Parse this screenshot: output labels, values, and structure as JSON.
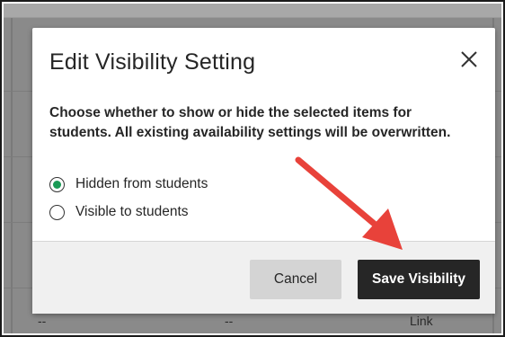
{
  "dialog": {
    "title": "Edit Visibility Setting",
    "prompt": "Choose whether to show or hide the selected items for students. All existing availability settings will be overwritten.",
    "options": [
      {
        "label": "Hidden from students",
        "selected": true
      },
      {
        "label": "Visible to students",
        "selected": false
      }
    ],
    "cancel_label": "Cancel",
    "save_label": "Save Visibility"
  },
  "background": {
    "cells": [
      "--",
      "--",
      "Link"
    ]
  },
  "colors": {
    "selected_radio": "#1a9a55",
    "annotation_arrow": "#e8423a",
    "save_button": "#262626"
  }
}
